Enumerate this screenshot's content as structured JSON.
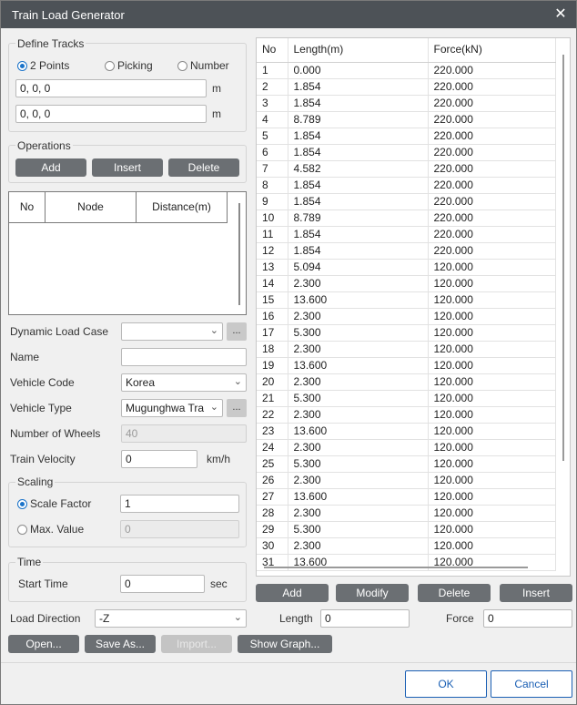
{
  "window": {
    "title": "Train Load Generator"
  },
  "define_tracks": {
    "label": "Define Tracks",
    "radio_2points": "2 Points",
    "radio_picking": "Picking",
    "radio_number": "Number",
    "point1": "0, 0, 0",
    "point2": "0, 0, 0",
    "unit": "m"
  },
  "operations": {
    "label": "Operations",
    "add": "Add",
    "insert": "Insert",
    "delete": "Delete"
  },
  "nodes_table": {
    "columns": [
      "No",
      "Node",
      "Distance(m)"
    ]
  },
  "form": {
    "dynamic_load_case_label": "Dynamic Load Case",
    "dynamic_load_case_value": "",
    "ellipsis": "...",
    "name_label": "Name",
    "name_value": "",
    "vehicle_code_label": "Vehicle Code",
    "vehicle_code_value": "Korea",
    "vehicle_type_label": "Vehicle Type",
    "vehicle_type_value": "Mugunghwa Tra",
    "wheels_label": "Number of Wheels",
    "wheels_value": "40",
    "velocity_label": "Train Velocity",
    "velocity_value": "0",
    "velocity_unit": "km/h"
  },
  "scaling": {
    "label": "Scaling",
    "scale_factor_label": "Scale Factor",
    "scale_factor_value": "1",
    "max_value_label": "Max. Value",
    "max_value_value": "0"
  },
  "time": {
    "label": "Time",
    "start_time_label": "Start Time",
    "start_time_value": "0",
    "unit": "sec"
  },
  "load_direction": {
    "label": "Load Direction",
    "value": "-Z"
  },
  "bottom_buttons": {
    "open": "Open...",
    "save_as": "Save As...",
    "import": "Import...",
    "show_graph": "Show Graph..."
  },
  "force_table": {
    "columns": [
      "No",
      "Length(m)",
      "Force(kN)"
    ],
    "rows": [
      [
        "1",
        "0.000",
        "220.000"
      ],
      [
        "2",
        "1.854",
        "220.000"
      ],
      [
        "3",
        "1.854",
        "220.000"
      ],
      [
        "4",
        "8.789",
        "220.000"
      ],
      [
        "5",
        "1.854",
        "220.000"
      ],
      [
        "6",
        "1.854",
        "220.000"
      ],
      [
        "7",
        "4.582",
        "220.000"
      ],
      [
        "8",
        "1.854",
        "220.000"
      ],
      [
        "9",
        "1.854",
        "220.000"
      ],
      [
        "10",
        "8.789",
        "220.000"
      ],
      [
        "11",
        "1.854",
        "220.000"
      ],
      [
        "12",
        "1.854",
        "220.000"
      ],
      [
        "13",
        "5.094",
        "120.000"
      ],
      [
        "14",
        "2.300",
        "120.000"
      ],
      [
        "15",
        "13.600",
        "120.000"
      ],
      [
        "16",
        "2.300",
        "120.000"
      ],
      [
        "17",
        "5.300",
        "120.000"
      ],
      [
        "18",
        "2.300",
        "120.000"
      ],
      [
        "19",
        "13.600",
        "120.000"
      ],
      [
        "20",
        "2.300",
        "120.000"
      ],
      [
        "21",
        "5.300",
        "120.000"
      ],
      [
        "22",
        "2.300",
        "120.000"
      ],
      [
        "23",
        "13.600",
        "120.000"
      ],
      [
        "24",
        "2.300",
        "120.000"
      ],
      [
        "25",
        "5.300",
        "120.000"
      ],
      [
        "26",
        "2.300",
        "120.000"
      ],
      [
        "27",
        "13.600",
        "120.000"
      ],
      [
        "28",
        "2.300",
        "120.000"
      ],
      [
        "29",
        "5.300",
        "120.000"
      ],
      [
        "30",
        "2.300",
        "120.000"
      ],
      [
        "31",
        "13.600",
        "120.000"
      ]
    ]
  },
  "right_buttons": {
    "add": "Add",
    "modify": "Modify",
    "delete": "Delete",
    "insert": "Insert"
  },
  "right_fields": {
    "length_label": "Length",
    "length_value": "0",
    "force_label": "Force",
    "force_value": "0"
  },
  "footer": {
    "ok": "OK",
    "cancel": "Cancel"
  }
}
